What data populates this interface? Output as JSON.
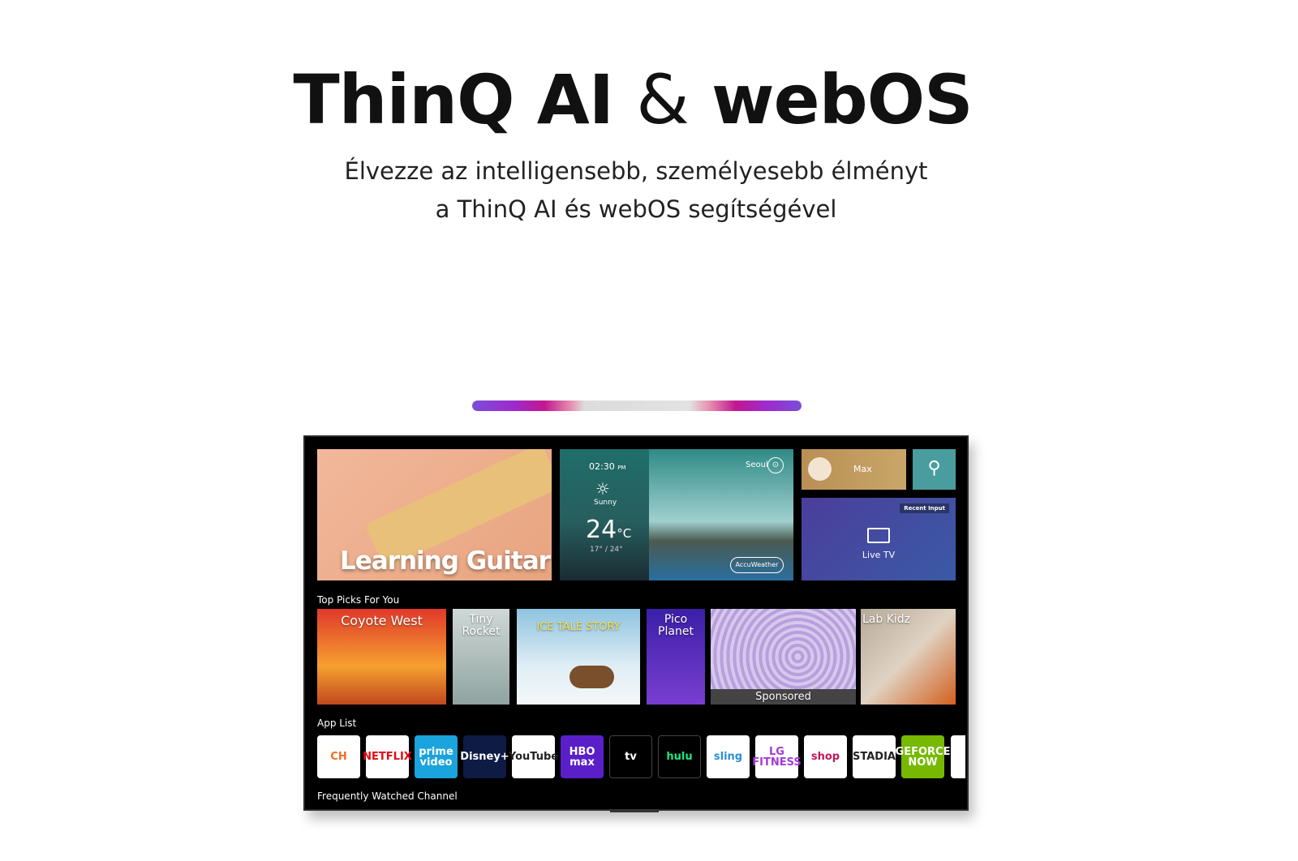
{
  "header": {
    "title_part1": "ThinQ AI",
    "title_amp": "&",
    "title_part2": "webOS",
    "subtitle_line1": "Élvezze az intelligensebb, személyesebb élményt",
    "subtitle_line2": "a ThinQ AI és webOS segítségével"
  },
  "tv": {
    "hero": {
      "title": "Learning Guitar"
    },
    "weather": {
      "time": "02:30",
      "ampm": "PM",
      "condition": "Sunny",
      "temp": "24",
      "unit": "°C",
      "range": "17° / 24°",
      "city": "Seoul",
      "provider": "AccuWeather"
    },
    "profile": {
      "name": "Max"
    },
    "live_tv": {
      "badge": "Recent Input",
      "label": "Live TV"
    },
    "top_picks": {
      "label": "Top Picks For You",
      "items": [
        {
          "title": "Coyote West"
        },
        {
          "title": "Tiny Rocket"
        },
        {
          "title": "ICE TALE STORY"
        },
        {
          "title": "Pico Planet"
        },
        {
          "title": "Sponsored"
        },
        {
          "title": "Lab Kidz"
        }
      ]
    },
    "app_list": {
      "label": "App List",
      "apps": [
        {
          "name": "CH",
          "bg": "#ffffff",
          "fg": "#f26b21"
        },
        {
          "name": "NETFLIX",
          "bg": "#ffffff",
          "fg": "#e50914"
        },
        {
          "name": "prime video",
          "bg": "#1aa3dc",
          "fg": "#ffffff"
        },
        {
          "name": "Disney+",
          "bg": "#0d1b45",
          "fg": "#ffffff"
        },
        {
          "name": "YouTube",
          "bg": "#ffffff",
          "fg": "#222222"
        },
        {
          "name": "HBO max",
          "bg": "#5a1fc8",
          "fg": "#ffffff"
        },
        {
          "name": "tv",
          "bg": "#000000",
          "fg": "#ffffff"
        },
        {
          "name": "hulu",
          "bg": "#000000",
          "fg": "#1ce783"
        },
        {
          "name": "sling",
          "bg": "#ffffff",
          "fg": "#2d8ed6"
        },
        {
          "name": "LG FITNESS",
          "bg": "#ffffff",
          "fg": "#a43bd6"
        },
        {
          "name": "shop",
          "bg": "#ffffff",
          "fg": "#c2185b"
        },
        {
          "name": "STADIA",
          "bg": "#ffffff",
          "fg": "#222222"
        },
        {
          "name": "GEFORCE NOW",
          "bg": "#76b900",
          "fg": "#ffffff"
        }
      ]
    },
    "frequent": {
      "label": "Frequently Watched Channel"
    }
  }
}
